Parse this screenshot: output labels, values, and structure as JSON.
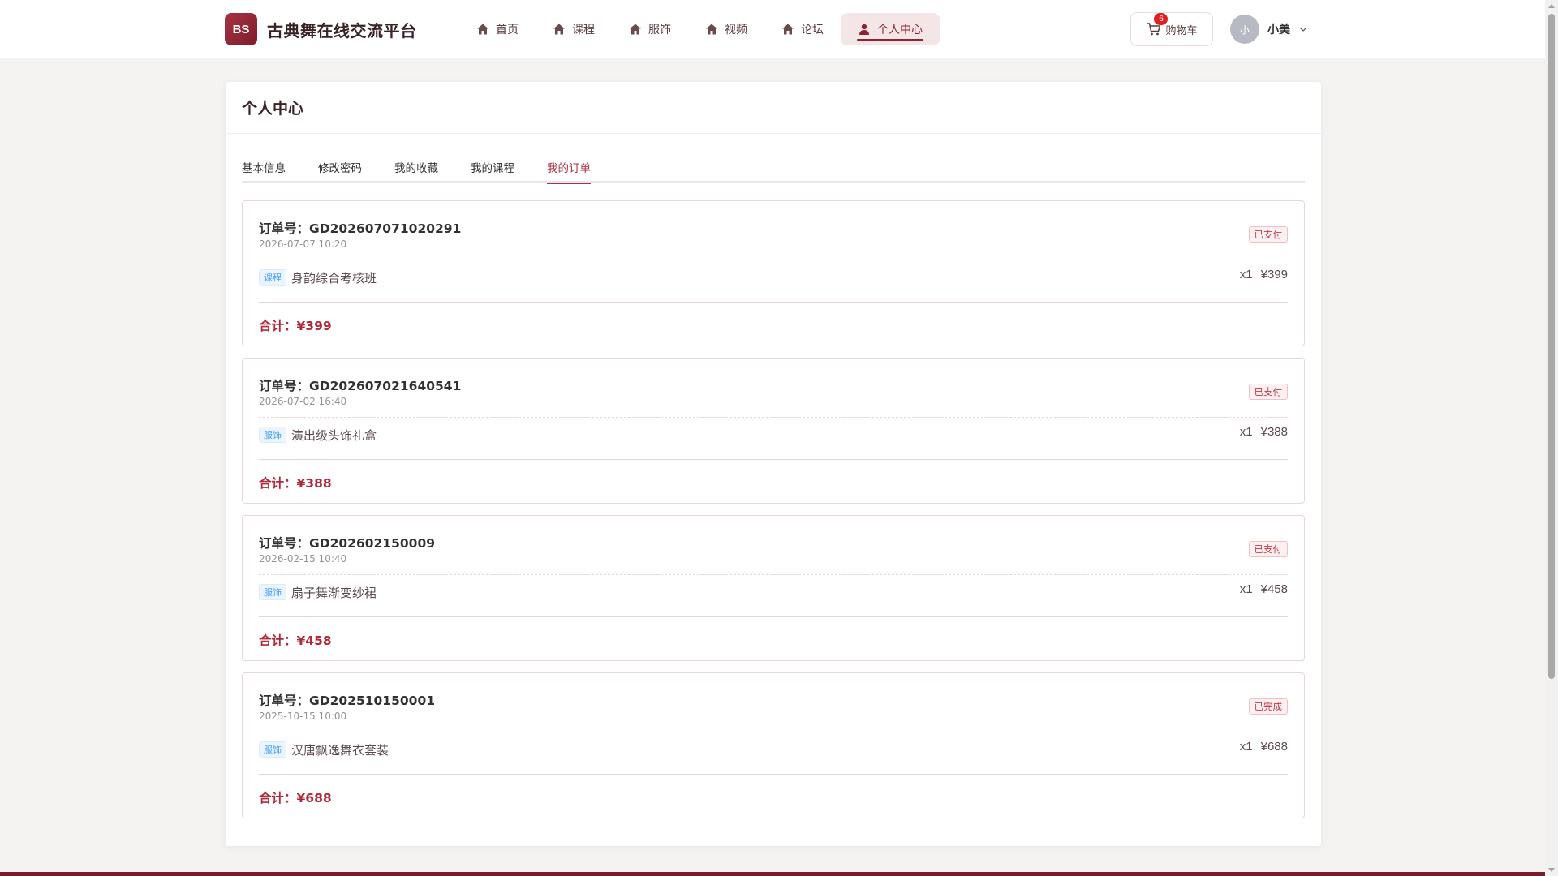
{
  "header": {
    "logo_text": "BS",
    "site_title": "古典舞在线交流平台",
    "nav": [
      {
        "label": "首页",
        "icon": "home-icon",
        "active": false
      },
      {
        "label": "课程",
        "icon": "home-icon",
        "active": false
      },
      {
        "label": "服饰",
        "icon": "home-icon",
        "active": false
      },
      {
        "label": "视频",
        "icon": "home-icon",
        "active": false
      },
      {
        "label": "论坛",
        "icon": "home-icon",
        "active": false
      },
      {
        "label": "个人中心",
        "icon": "user-icon",
        "active": true
      }
    ],
    "cart": {
      "label": "购物车",
      "count": "6",
      "icon": "cart-icon"
    },
    "user": {
      "avatar_text": "小",
      "name": "小美",
      "icon": "chevron-down-icon"
    }
  },
  "page": {
    "title": "个人中心",
    "tabs": [
      {
        "label": "基本信息",
        "active": false
      },
      {
        "label": "修改密码",
        "active": false
      },
      {
        "label": "我的收藏",
        "active": false
      },
      {
        "label": "我的课程",
        "active": false
      },
      {
        "label": "我的订单",
        "active": true
      }
    ]
  },
  "orders": [
    {
      "order_no": "订单号：GD202607071020291",
      "date": "2026-07-07 10:20",
      "status": "已支付",
      "item_tag": "课程",
      "item_name": "身韵综合考核班",
      "qty": "x1",
      "price": "¥399",
      "total": "合计：¥399"
    },
    {
      "order_no": "订单号：GD202607021640541",
      "date": "2026-07-02 16:40",
      "status": "已支付",
      "item_tag": "服饰",
      "item_name": "演出级头饰礼盒",
      "qty": "x1",
      "price": "¥388",
      "total": "合计：¥388"
    },
    {
      "order_no": "订单号：GD202602150009",
      "date": "2026-02-15 10:40",
      "status": "已支付",
      "item_tag": "服饰",
      "item_name": "扇子舞渐变纱裙",
      "qty": "x1",
      "price": "¥458",
      "total": "合计：¥458"
    },
    {
      "order_no": "订单号：GD202510150001",
      "date": "2025-10-15 10:00",
      "status": "已完成",
      "item_tag": "服饰",
      "item_name": "汉唐飘逸舞衣套装",
      "qty": "x1",
      "price": "¥688",
      "total": "合计：¥688"
    }
  ],
  "colors": {
    "brand": "#8c2433",
    "accent": "#a83242",
    "total_text": "#b0283a",
    "course_tag": "#409eff",
    "page_bg": "#f5f3f1"
  }
}
